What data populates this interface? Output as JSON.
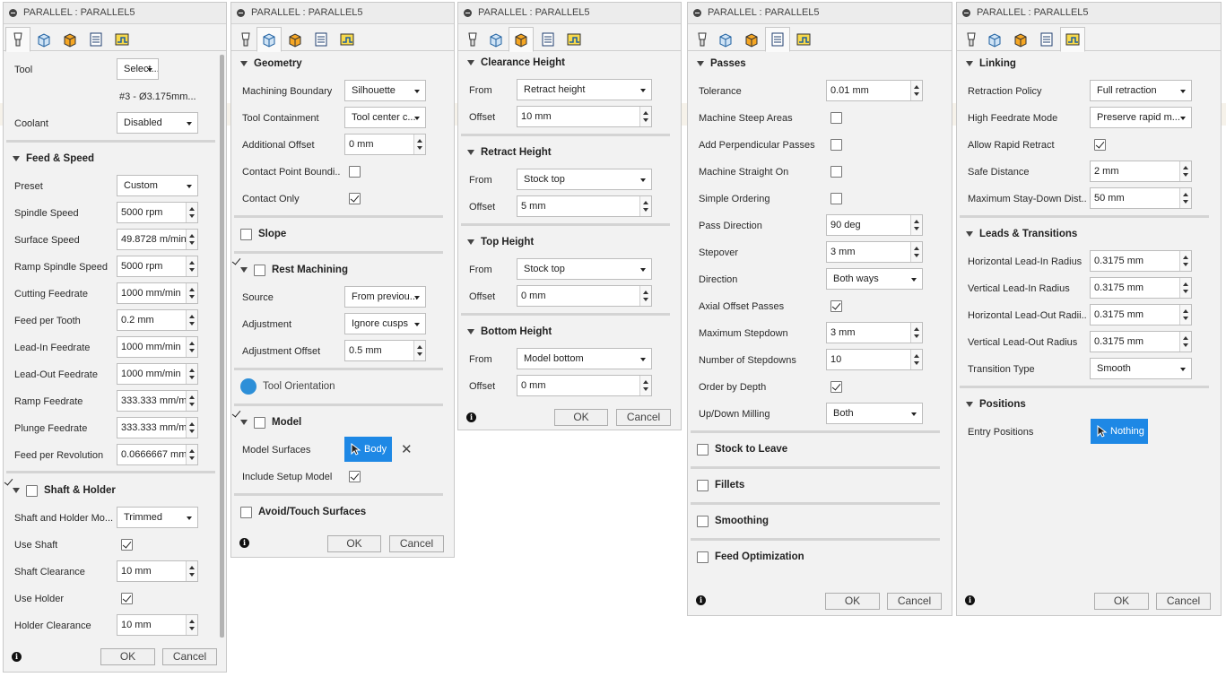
{
  "panel_title": "PARALLEL : PARALLEL5",
  "ok_label": "OK",
  "cancel_label": "Cancel",
  "info_glyph": "i",
  "tab_icons": [
    "tool-tab-icon",
    "geometry-tab-icon",
    "heights-tab-icon",
    "passes-tab-icon",
    "linking-tab-icon"
  ],
  "colors": {
    "accent_blue": "#1e88e5",
    "panel_bg": "#f2f2f2"
  },
  "tool_panel": {
    "tool_label": "Tool",
    "tool_button": "Select...",
    "tool_info": "#3 - Ø3.175mm...",
    "coolant_label": "Coolant",
    "coolant_value": "Disabled",
    "feed_section": "Feed & Speed",
    "preset_label": "Preset",
    "preset_value": "Custom",
    "spindle_label": "Spindle Speed",
    "spindle_value": "5000 rpm",
    "surface_label": "Surface Speed",
    "surface_value": "49.8728 m/min",
    "ramp_spindle_label": "Ramp Spindle Speed",
    "ramp_spindle_value": "5000 rpm",
    "cutting_label": "Cutting Feedrate",
    "cutting_value": "1000 mm/min",
    "tooth_label": "Feed per Tooth",
    "tooth_value": "0.2 mm",
    "leadin_label": "Lead-In Feedrate",
    "leadin_value": "1000 mm/min",
    "leadout_label": "Lead-Out Feedrate",
    "leadout_value": "1000 mm/min",
    "ramp_feed_label": "Ramp Feedrate",
    "ramp_feed_value": "333.333 mm/mi",
    "plunge_label": "Plunge Feedrate",
    "plunge_value": "333.333 mm/mi",
    "rev_label": "Feed per Revolution",
    "rev_value": "0.0666667 mm",
    "shaft_section": "Shaft & Holder",
    "shaft_mode_label": "Shaft and Holder Mo...",
    "shaft_mode_value": "Trimmed",
    "use_shaft_label": "Use Shaft",
    "shaft_clear_label": "Shaft Clearance",
    "shaft_clear_value": "10 mm",
    "use_holder_label": "Use Holder",
    "holder_clear_label": "Holder Clearance",
    "holder_clear_value": "10 mm"
  },
  "geometry_panel": {
    "geometry_section": "Geometry",
    "boundary_label": "Machining Boundary",
    "boundary_value": "Silhouette",
    "containment_label": "Tool Containment",
    "containment_value": "Tool center c...",
    "addoffset_label": "Additional Offset",
    "addoffset_value": "0 mm",
    "contact_bound_label": "Contact Point Boundi...",
    "contact_only_label": "Contact Only",
    "slope_section": "Slope",
    "rest_section": "Rest Machining",
    "source_label": "Source",
    "source_value": "From previou...",
    "adjust_label": "Adjustment",
    "adjust_value": "Ignore cusps",
    "adjoffset_label": "Adjustment Offset",
    "adjoffset_value": "0.5 mm",
    "orientation_section": "Tool Orientation",
    "model_section": "Model",
    "surfaces_label": "Model Surfaces",
    "surfaces_button": "Body",
    "clear_glyph": "✕",
    "include_label": "Include Setup Model",
    "avoid_section": "Avoid/Touch Surfaces"
  },
  "heights_panel": {
    "clearance_section": "Clearance Height",
    "clear_from_label": "From",
    "clear_from_value": "Retract height",
    "clear_offset_label": "Offset",
    "clear_offset_value": "10 mm",
    "retract_section": "Retract Height",
    "retract_from_label": "From",
    "retract_from_value": "Stock top",
    "retract_offset_label": "Offset",
    "retract_offset_value": "5 mm",
    "top_section": "Top Height",
    "top_from_label": "From",
    "top_from_value": "Stock top",
    "top_offset_label": "Offset",
    "top_offset_value": "0 mm",
    "bottom_section": "Bottom Height",
    "bottom_from_label": "From",
    "bottom_from_value": "Model bottom",
    "bottom_offset_label": "Offset",
    "bottom_offset_value": "0 mm"
  },
  "passes_panel": {
    "passes_section": "Passes",
    "tolerance_label": "Tolerance",
    "tolerance_value": "0.01 mm",
    "steep_label": "Machine Steep Areas",
    "perp_label": "Add Perpendicular Passes",
    "straight_label": "Machine Straight On",
    "simple_label": "Simple Ordering",
    "direction_label": "Pass Direction",
    "direction_value": "90 deg",
    "stepover_label": "Stepover",
    "stepover_value": "3 mm",
    "dir_label": "Direction",
    "dir_value": "Both ways",
    "axial_label": "Axial Offset Passes",
    "maxstep_label": "Maximum Stepdown",
    "maxstep_value": "3 mm",
    "numstep_label": "Number of Stepdowns",
    "numstep_value": "10",
    "depth_label": "Order by Depth",
    "milling_label": "Up/Down Milling",
    "milling_value": "Both",
    "stock_section": "Stock to Leave",
    "fillets_section": "Fillets",
    "smoothing_section": "Smoothing",
    "feedopt_section": "Feed Optimization"
  },
  "linking_panel": {
    "linking_section": "Linking",
    "retraction_label": "Retraction Policy",
    "retraction_value": "Full retraction",
    "highfeed_label": "High Feedrate Mode",
    "highfeed_value": "Preserve rapid m...",
    "rapid_label": "Allow Rapid Retract",
    "safe_label": "Safe Distance",
    "safe_value": "2 mm",
    "staydown_label": "Maximum Stay-Down Dist...",
    "staydown_value": "50 mm",
    "leads_section": "Leads & Transitions",
    "hlin_label": "Horizontal Lead-In Radius",
    "hlin_value": "0.3175 mm",
    "vlin_label": "Vertical Lead-In Radius",
    "vlin_value": "0.3175 mm",
    "hlout_label": "Horizontal Lead-Out Radii...",
    "hlout_value": "0.3175 mm",
    "vlout_label": "Vertical Lead-Out Radius",
    "vlout_value": "0.3175 mm",
    "transition_label": "Transition Type",
    "transition_value": "Smooth",
    "positions_section": "Positions",
    "entry_label": "Entry Positions",
    "entry_button": "Nothing"
  }
}
